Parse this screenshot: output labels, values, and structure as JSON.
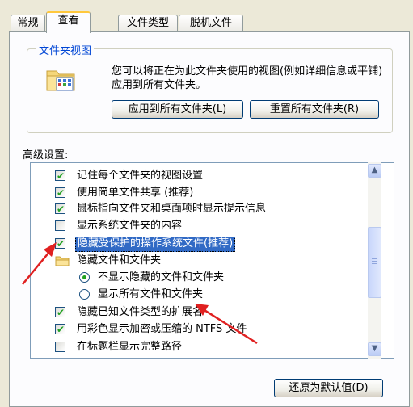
{
  "tabs": [
    "常规",
    "查看",
    "文件类型",
    "脱机文件"
  ],
  "active_tab": "查看",
  "folder_views": {
    "title": "文件夹视图",
    "description": "您可以将正在为此文件夹使用的视图(例如详细信息或平铺)应用到所有文件夹。",
    "apply_button": "应用到所有文件夹(L)",
    "reset_button": "重置所有文件夹(R)"
  },
  "advanced": {
    "label": "高级设置:",
    "items": [
      {
        "type": "checkbox",
        "checked": true,
        "label": "记住每个文件夹的视图设置"
      },
      {
        "type": "checkbox",
        "checked": true,
        "label": "使用简单文件共享 (推荐)"
      },
      {
        "type": "checkbox",
        "checked": true,
        "label": "鼠标指向文件夹和桌面项时显示提示信息"
      },
      {
        "type": "checkbox",
        "checked": false,
        "label": "显示系统文件夹的内容"
      },
      {
        "type": "checkbox",
        "checked": true,
        "label": "隐藏受保护的操作系统文件(推荐)",
        "selected": true
      },
      {
        "type": "folder",
        "label": "隐藏文件和文件夹"
      },
      {
        "type": "radio",
        "checked": true,
        "label": "不显示隐藏的文件和文件夹"
      },
      {
        "type": "radio",
        "checked": false,
        "label": "显示所有文件和文件夹"
      },
      {
        "type": "checkbox",
        "checked": true,
        "label": "隐藏已知文件类型的扩展名"
      },
      {
        "type": "checkbox",
        "checked": true,
        "label": "用彩色显示加密或压缩的 NTFS 文件"
      },
      {
        "type": "checkbox",
        "checked": false,
        "label": "在标题栏显示完整路径"
      }
    ]
  },
  "restore_button": "还原为默认值(D)",
  "colors": {
    "accent": "#316ac5",
    "arrow": "#e02020",
    "tab_highlight": "#ffc83c"
  }
}
